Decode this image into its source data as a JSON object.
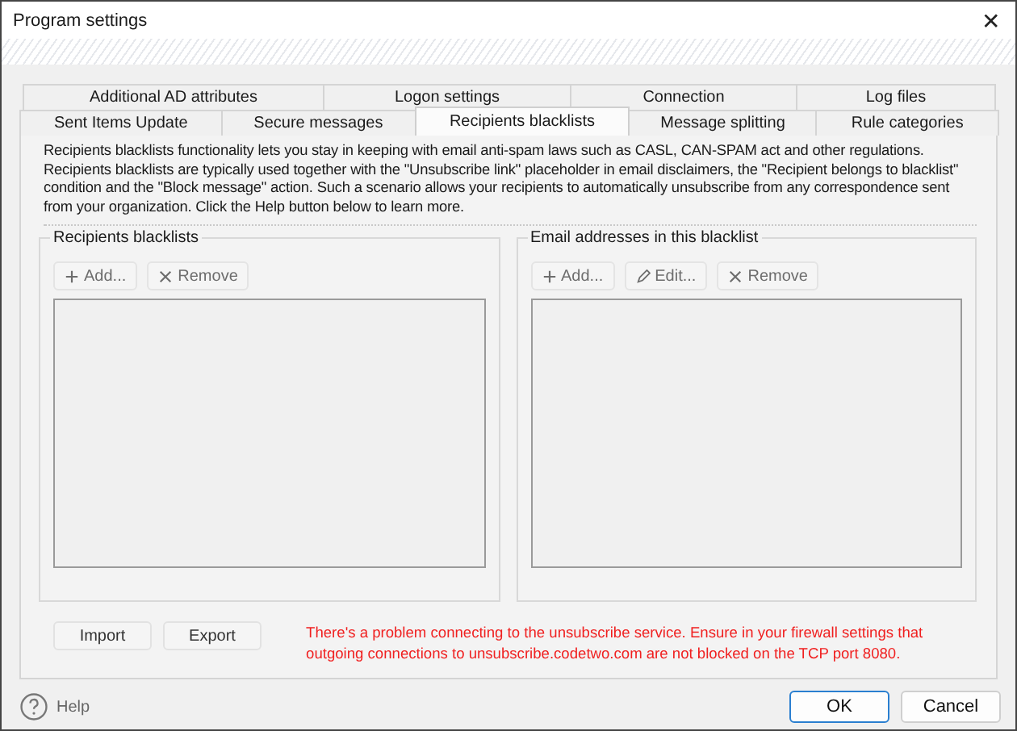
{
  "window": {
    "title": "Program settings",
    "close": "✕"
  },
  "tab_rows": [
    [
      {
        "label": "Additional AD attributes",
        "selected": false
      },
      {
        "label": "Logon settings",
        "selected": false
      },
      {
        "label": "Connection",
        "selected": false
      },
      {
        "label": "Log files",
        "selected": false
      }
    ],
    [
      {
        "label": "Sent Items Update",
        "selected": false
      },
      {
        "label": "Secure messages",
        "selected": false
      },
      {
        "label": "Recipients blacklists",
        "selected": true
      },
      {
        "label": "Message splitting",
        "selected": false
      },
      {
        "label": "Rule categories",
        "selected": false
      }
    ]
  ],
  "description": "Recipients blacklists functionality lets you stay in keeping with email anti-spam laws such as CASL, CAN-SPAM act and other regulations. Recipients blacklists are typically used together with the \"Unsubscribe link\" placeholder in email disclaimers, the \"Recipient belongs to blacklist\" condition and the \"Block message\" action. Such a scenario allows your recipients to automatically unsubscribe from any correspondence sent from your organization. Click the Help button below to learn more.",
  "groups": [
    {
      "title": "Recipients blacklists",
      "buttons": [
        {
          "kind": "add",
          "label": "Add...",
          "disabled": true
        },
        {
          "kind": "remove",
          "label": "Remove",
          "disabled": true
        }
      ]
    },
    {
      "title": "Email addresses in this blacklist",
      "buttons": [
        {
          "kind": "add",
          "label": "Add...",
          "disabled": true
        },
        {
          "kind": "edit",
          "label": "Edit...",
          "disabled": true
        },
        {
          "kind": "remove",
          "label": "Remove",
          "disabled": true
        }
      ]
    }
  ],
  "actions": [
    {
      "label": "Import"
    },
    {
      "label": "Export"
    }
  ],
  "error": "There's a problem connecting to the unsubscribe service. Ensure in your firewall settings that outgoing connections to unsubscribe.codetwo.com are not blocked on the TCP port 8080.",
  "footer": {
    "help": "Help",
    "ok": "OK",
    "cancel": "Cancel"
  }
}
